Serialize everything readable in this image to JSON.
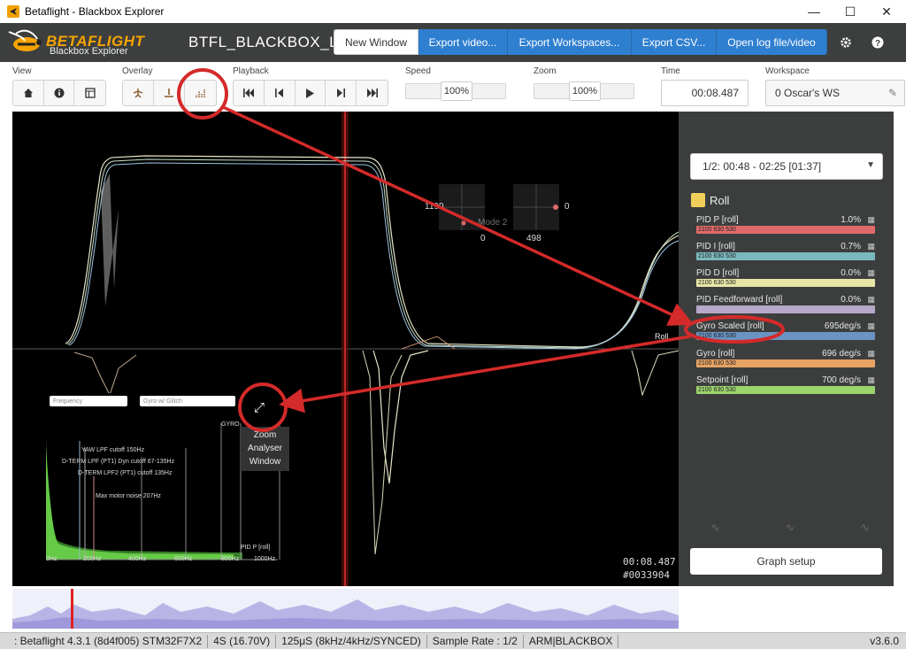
{
  "window": {
    "title": "Betaflight - Blackbox Explorer",
    "minimize": "—",
    "maximize": "☐",
    "close": "✕"
  },
  "header": {
    "brand": "BETAFLIGHT",
    "brand_sub": "Blackbox Explorer",
    "log_file": "BTFL_BLACKBOX_LOG",
    "buttons": {
      "new_window": "New Window",
      "export_video": "Export video...",
      "export_workspaces": "Export Workspaces...",
      "export_csv": "Export CSV...",
      "open_log": "Open log file/video"
    },
    "settings_icon": "gear-icon",
    "help_icon": "help-icon"
  },
  "toolbar": {
    "view_label": "View",
    "overlay_label": "Overlay",
    "playback_label": "Playback",
    "speed_label": "Speed",
    "speed_value": "100%",
    "speed_level": 0.5,
    "zoom_label": "Zoom",
    "zoom_value": "100%",
    "zoom_level": 0.5,
    "time_label": "Time",
    "time_value": "00:08.487",
    "workspace_label": "Workspace",
    "workspace_value": "0 Oscar's WS",
    "view_icons": [
      "home-icon",
      "info-icon",
      "table-icon"
    ],
    "overlay_icons": [
      "sticks-icon",
      "craft-icon",
      "analyser-icon"
    ],
    "playback_icons": [
      "skip-start-icon",
      "step-back-icon",
      "play-icon",
      "step-forward-icon",
      "skip-end-icon"
    ]
  },
  "graph": {
    "time": "00:08.487",
    "frame": "#0033904",
    "roll_label": "Roll",
    "stick_left_value": "1190",
    "stick_left_sub": "0",
    "stick_left_hidden": "Mode 2",
    "stick_right_sub": "498",
    "stick_right_value": "0",
    "analyser": {
      "select_1": "Frequency",
      "select_2": "Gyro w/ Glitch",
      "gyro_label": "GYRO",
      "zoom_tooltip_1": "Zoom",
      "zoom_tooltip_2": "Analyser",
      "zoom_tooltip_3": "Window",
      "lines": [
        "YAW LPF cutoff 150Hz",
        "D-TERM LPF (PT1) Dyn cutoff 67-135Hz",
        "D-TERM LPF2 (PT1) cutoff 135Hz",
        "Max motor noise 207Hz"
      ],
      "ticks": [
        "0Hz",
        "200Hz",
        "400Hz",
        "600Hz",
        "800Hz",
        "1000Hz"
      ],
      "pid_label": "PID P [roll]"
    }
  },
  "panel": {
    "segment": "1/2: 00:48 - 02:25 [01:37]",
    "axis": "Roll",
    "fields": [
      {
        "name": "PID P [roll]",
        "value": "1.0%",
        "color": "#e06a6a",
        "scale": "2100 630 530"
      },
      {
        "name": "PID I [roll]",
        "value": "0.7%",
        "color": "#7ab9bf",
        "scale": "2100 630 530"
      },
      {
        "name": "PID D [roll]",
        "value": "0.0%",
        "color": "#e8e6a6",
        "scale": "2100 630 530"
      },
      {
        "name": "PID Feedforward [roll]",
        "value": "0.0%",
        "color": "#b6a8c8",
        "scale": ""
      },
      {
        "name": "Gyro Scaled [roll]",
        "value": "695deg/s",
        "color": "#6a94c4",
        "scale": "2100 630 530"
      },
      {
        "name": "Gyro [roll]",
        "value": "696 deg/s",
        "color": "#e6a364",
        "scale": "2100 630 530"
      },
      {
        "name": "Setpoint [roll]",
        "value": "700 deg/s",
        "color": "#9bd36d",
        "scale": "2100 630 530"
      }
    ],
    "graph_setup": "Graph setup"
  },
  "status": {
    "firmware": ": Betaflight 4.3.1 (8d4f005) STM32F7X2",
    "battery": "4S (16.70V)",
    "loop": "125μS (8kHz/4kHz/SYNCED)",
    "sample_rate": "Sample Rate : 1/2",
    "flags": "ARM|BLACKBOX",
    "version": "v3.6.0"
  },
  "colors": {
    "header_bg": "#3d3f3f",
    "accent_blue": "#2f7fd0",
    "brand_orange": "#f6a400",
    "annotation_red": "#d42a2a"
  }
}
